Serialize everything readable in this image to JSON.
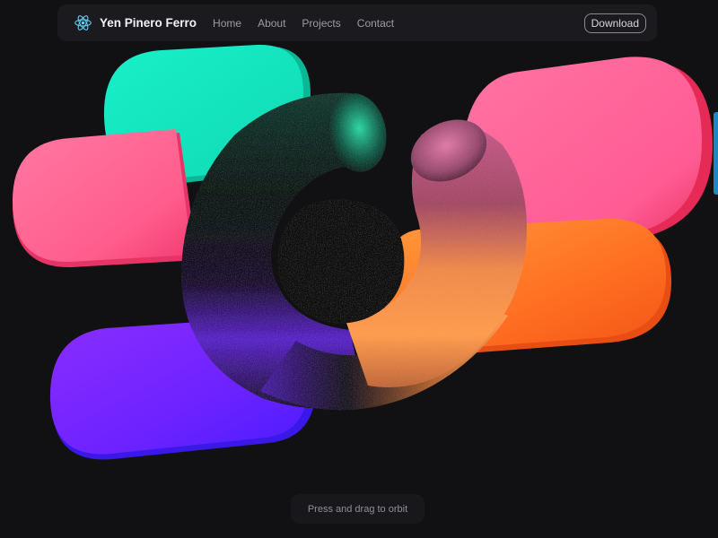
{
  "brand": {
    "name": "Yen Pinero Ferro",
    "icon": "react-atom-icon",
    "icon_color": "#5ecbf0"
  },
  "nav": {
    "links": [
      {
        "label": "Home"
      },
      {
        "label": "About"
      },
      {
        "label": "Projects"
      },
      {
        "label": "Contact"
      }
    ],
    "download_label": "Download"
  },
  "hint": {
    "text": "Press and drag to orbit"
  },
  "colors": {
    "background": "#111114",
    "nav_background": "#1b1b1f",
    "teal": "#12e3bd",
    "pink": "#ff6b98",
    "orange": "#ff7d2e",
    "purple": "#7a2eff",
    "torus_dark": "#0f1512",
    "edge_accent": "#1c86c7"
  }
}
